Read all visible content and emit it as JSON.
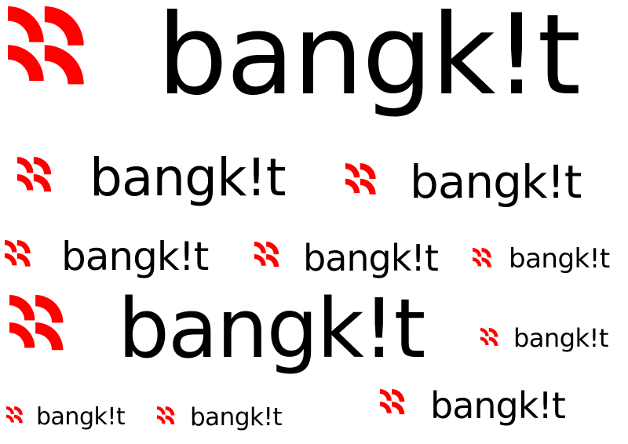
{
  "brand": {
    "name": "bangkit",
    "wordmark_text": "bangk!t",
    "primary_color": "#ff0000",
    "text_color": "#000000",
    "background_color": "#ffffff",
    "icon": "quarter-arc-mark-icon"
  },
  "logos": [
    {
      "id": "logo-1"
    },
    {
      "id": "logo-2"
    },
    {
      "id": "logo-3"
    },
    {
      "id": "logo-4"
    },
    {
      "id": "logo-5"
    },
    {
      "id": "logo-6"
    },
    {
      "id": "logo-7"
    },
    {
      "id": "logo-8"
    },
    {
      "id": "logo-9"
    },
    {
      "id": "logo-10"
    },
    {
      "id": "logo-11"
    }
  ]
}
